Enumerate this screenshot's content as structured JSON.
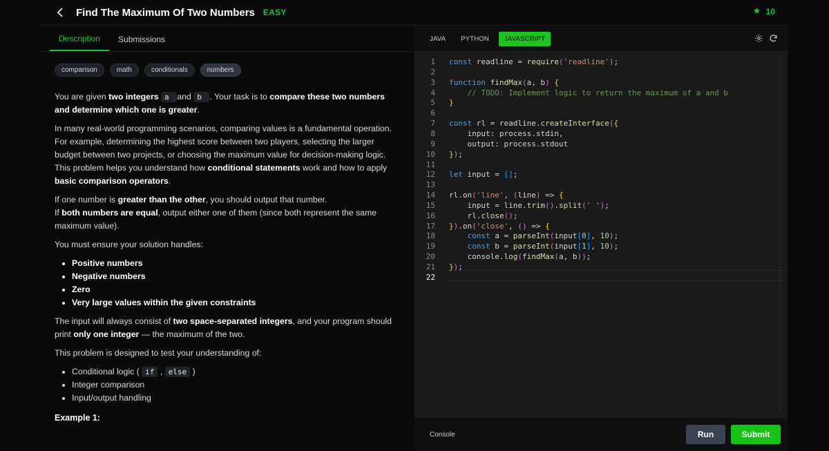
{
  "header": {
    "title": "Find The Maximum Of Two Numbers",
    "difficulty": "EASY",
    "points": "10"
  },
  "left_tabs": [
    {
      "label": "Description",
      "active": true
    },
    {
      "label": "Submissions",
      "active": false
    }
  ],
  "tags": [
    {
      "label": "comparison",
      "active": false
    },
    {
      "label": "math",
      "active": false
    },
    {
      "label": "conditionals",
      "active": false
    },
    {
      "label": "numbers",
      "active": true
    }
  ],
  "description": {
    "p1_a": "You are given ",
    "p1_b": "two integers",
    "p1_c": " a ",
    "p1_d": " and ",
    "p1_e": " b ",
    "p1_f": ". Your task is to ",
    "p1_g": "compare these two numbers and determine which one is greater",
    "p1_h": ".",
    "p2_a": "In many real-world programming scenarios, comparing values is a fundamental operation. For example, determining the highest score between two players, selecting the larger budget between two projects, or choosing the maximum value for decision-making logic. This problem helps you understand how ",
    "p2_b": "conditional statements",
    "p2_c": " work and how to apply ",
    "p2_d": "basic comparison operators",
    "p2_e": ".",
    "p3_a": "If one number is ",
    "p3_b": "greater than the other",
    "p3_c": ", you should output that number.",
    "p3_d": "If ",
    "p3_e": "both numbers are equal",
    "p3_f": ", output either one of them (since both represent the same maximum value).",
    "p4": "You must ensure your solution handles:",
    "handles": [
      "Positive numbers",
      "Negative numbers",
      "Zero",
      "Very large values within the given constraints"
    ],
    "p5_a": "The input will always consist of ",
    "p5_b": "two space-separated integers",
    "p5_c": ", and your program should print ",
    "p5_d": "only one integer",
    "p5_e": " — the maximum of the two.",
    "p6": "This problem is designed to test your understanding of:",
    "topics_1_a": "Conditional logic ( ",
    "topics_1_b": "if",
    "topics_1_c": " , ",
    "topics_1_d": "else",
    "topics_1_e": " )",
    "topics_2": "Integer comparison",
    "topics_3": "Input/output handling",
    "example_heading": "Example 1:"
  },
  "languages": [
    {
      "label": "JAVA",
      "active": false
    },
    {
      "label": "PYTHON",
      "active": false
    },
    {
      "label": "JAVASCRIPT",
      "active": true
    }
  ],
  "code_lines": [
    "const readline = require('readline');",
    "",
    "function findMax(a, b) {",
    "    // TODO: Implement logic to return the maximum of a and b",
    "}",
    "",
    "const rl = readline.createInterface({",
    "    input: process.stdin,",
    "    output: process.stdout",
    "});",
    "",
    "let input = [];",
    "",
    "rl.on('line', (line) => {",
    "    input = line.trim().split(' ');",
    "    rl.close();",
    "}).on('close', () => {",
    "    const a = parseInt(input[0], 10);",
    "    const b = parseInt(input[1], 10);",
    "    console.log(findMax(a, b));",
    "});",
    ""
  ],
  "footer": {
    "console_label": "Console",
    "run_label": "Run",
    "submit_label": "Submit"
  },
  "colors": {
    "accent_green": "#21c33a",
    "run_button": "#3a4352",
    "submit_button": "#16c316"
  },
  "icons": [
    "chevron-left-icon",
    "star-icon",
    "settings-icon",
    "reset-icon"
  ]
}
